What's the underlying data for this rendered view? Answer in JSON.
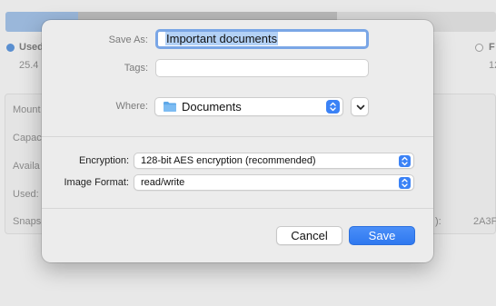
{
  "background_window": {
    "legend": {
      "used_label": "Used",
      "used_value": "25.4",
      "free_label": "F",
      "free_value": "12"
    },
    "info_rows": [
      "Mount",
      "Capac",
      "Availa",
      "Used:",
      "Snaps"
    ],
    "right_fragments": {
      "colon": "):",
      "id": "2A3F"
    }
  },
  "sheet": {
    "save_as_label": "Save As:",
    "save_as_value": "Important documents",
    "tags_label": "Tags:",
    "tags_value": "",
    "where_label": "Where:",
    "where_value": "Documents",
    "encryption_label": "Encryption:",
    "encryption_value": "128-bit AES encryption (recommended)",
    "image_format_label": "Image Format:",
    "image_format_value": "read/write",
    "cancel_label": "Cancel",
    "save_label": "Save"
  },
  "colors": {
    "accent": "#3b82f6",
    "folder": "#5ea8e8",
    "selection": "#b3d1f6"
  },
  "icons": {
    "where_folder": "folder-icon",
    "where_stepper": "updown-chevron-icon",
    "expand": "chevron-down-icon"
  }
}
